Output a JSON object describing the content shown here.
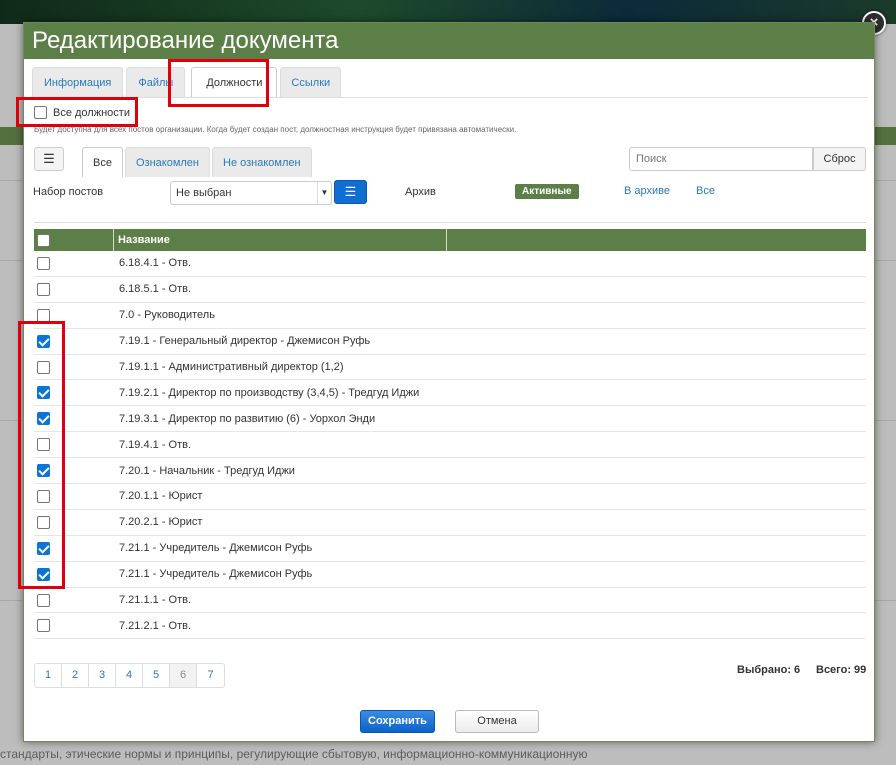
{
  "modal": {
    "title": "Редактирование документа",
    "close_glyph": "×"
  },
  "tabs": [
    {
      "label": "Информация",
      "active": false
    },
    {
      "label": "Файлы",
      "active": false
    },
    {
      "label": "Должности",
      "active": true
    },
    {
      "label": "Ссылки",
      "active": false
    }
  ],
  "all_positions": {
    "label": "Все должности",
    "checked": false,
    "hint": "Будет доступна для всех постов организации. Когда будет создан пост, должностная инструкция будет привязана автоматически."
  },
  "toolbar": {
    "list_icon": "list-icon",
    "subtabs": [
      {
        "label": "Все",
        "active": true
      },
      {
        "label": "Ознакомлен",
        "active": false
      },
      {
        "label": "Не ознакомлен",
        "active": false
      }
    ],
    "search_placeholder": "Поиск",
    "reset_label": "Сброс"
  },
  "filters": {
    "post_set_label": "Набор постов",
    "post_set_value": "Не выбран",
    "archive_label": "Архив",
    "archive_active": "Активные",
    "archive_in": "В архиве",
    "archive_all": "Все"
  },
  "table": {
    "header_name": "Название",
    "rows": [
      {
        "name": "6.18.4.1 - Отв.",
        "checked": false
      },
      {
        "name": "6.18.5.1 - Отв.",
        "checked": false
      },
      {
        "name": "7.0 - Руководитель",
        "checked": false
      },
      {
        "name": "7.19.1 - Генеральный директор - Джемисон Руфь",
        "checked": true
      },
      {
        "name": "7.19.1.1 - Административный директор (1,2)",
        "checked": false
      },
      {
        "name": "7.19.2.1 - Директор по производству (3,4,5) - Тредгуд Иджи",
        "checked": true
      },
      {
        "name": "7.19.3.1 - Директор по развитию (6) - Уорхол Энди",
        "checked": true
      },
      {
        "name": "7.19.4.1 - Отв.",
        "checked": false
      },
      {
        "name": "7.20.1 - Начальник - Тредгуд Иджи",
        "checked": true
      },
      {
        "name": "7.20.1.1 - Юрист",
        "checked": false
      },
      {
        "name": "7.20.2.1 - Юрист",
        "checked": false
      },
      {
        "name": "7.21.1 - Учредитель - Джемисон Руфь",
        "checked": true
      },
      {
        "name": "7.21.1 - Учредитель - Джемисон Руфь",
        "checked": true
      },
      {
        "name": "7.21.1.1 - Отв.",
        "checked": false
      },
      {
        "name": "7.21.2.1 - Отв.",
        "checked": false
      }
    ]
  },
  "pagination": {
    "pages": [
      "1",
      "2",
      "3",
      "4",
      "5",
      "6",
      "7"
    ],
    "current": "6"
  },
  "stats": {
    "selected": "Выбрано: 6",
    "total": "Всего: 99"
  },
  "footer": {
    "save_label": "Сохранить",
    "cancel_label": "Отмена"
  },
  "background": {
    "footer_text": "стандарты, этические нормы и принципы, регулирующие сбытовую, информационно-коммуникационную"
  },
  "colors": {
    "header_green": "#5c7f47",
    "link_blue": "#2a7ab8",
    "primary_blue": "#0f6fd1",
    "highlight_red": "#e0000b"
  }
}
